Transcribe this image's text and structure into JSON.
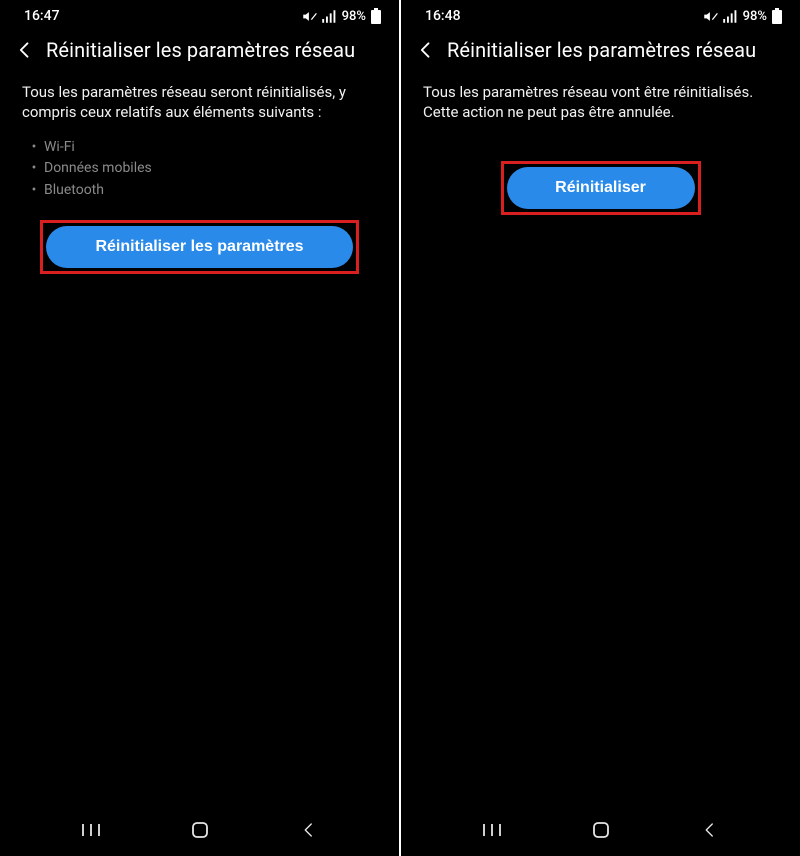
{
  "left": {
    "status": {
      "time": "16:47",
      "battery_pct": "98%"
    },
    "header": {
      "title": "Réinitialiser les paramètres réseau"
    },
    "body": {
      "intro": "Tous les paramètres réseau seront réinitialisés, y compris ceux relatifs aux éléments suivants :",
      "items": [
        "Wi-Fi",
        "Données mobiles",
        "Bluetooth"
      ]
    },
    "button": {
      "label": "Réinitialiser les paramètres"
    }
  },
  "right": {
    "status": {
      "time": "16:48",
      "battery_pct": "98%"
    },
    "header": {
      "title": "Réinitialiser les paramètres réseau"
    },
    "body": {
      "intro": "Tous les paramètres réseau vont être réinitialisés. Cette action ne peut pas être annulée."
    },
    "button": {
      "label": "Réinitialiser"
    }
  },
  "icons": {
    "mute": "volume-mute-icon",
    "signal": "signal-icon",
    "battery": "battery-icon",
    "back": "chevron-left-icon",
    "nav_recents": "recents-icon",
    "nav_home": "home-icon",
    "nav_back": "back-icon"
  },
  "colors": {
    "accent": "#2a8aea",
    "highlight_border": "#d91f1f",
    "bg": "#000000",
    "text": "#ffffff",
    "muted": "#8a8a8a"
  }
}
